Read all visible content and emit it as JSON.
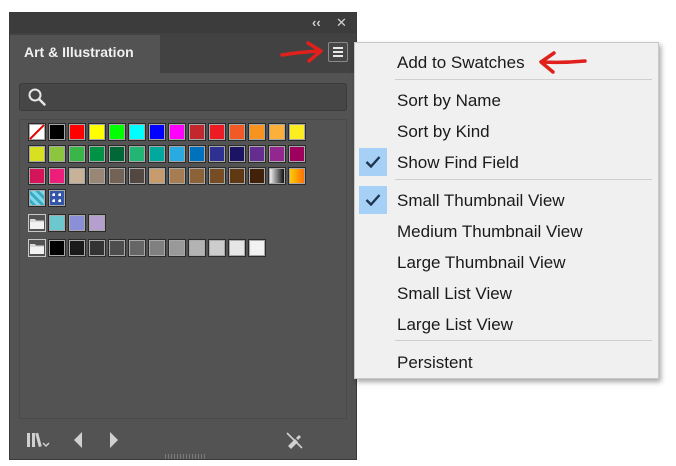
{
  "panel": {
    "collapse_glyph": "‹‹",
    "close_glyph": "✕",
    "tab_title": "Art & Illustration",
    "menu_button_icon": "hamburger-menu-icon",
    "search_icon": "search-icon",
    "search_value": ""
  },
  "swatch_rows": [
    [
      "none",
      "#000000",
      "#ff0000",
      "#ffff00",
      "#00ff00",
      "#00ffff",
      "#0000ff",
      "#ff00ff",
      "#c1272d",
      "#ed1c24",
      "#f15a24",
      "#f7931e",
      "#fbb03b",
      "#fcee21"
    ],
    [
      "#d9e021",
      "#8cc63f",
      "#39b54a",
      "#009245",
      "#006837",
      "#22b573",
      "#00a99d",
      "#29abe2",
      "#0071bc",
      "#2e3192",
      "#1b1464",
      "#662d91",
      "#93278f",
      "#9e005d"
    ],
    [
      "#d4145a",
      "#ed1e79",
      "#c7b299",
      "#998675",
      "#736357",
      "#534741",
      "#c69c6d",
      "#a67c52",
      "#8c6239",
      "#754c24",
      "#603813",
      "#42210b",
      "grad",
      "grad2"
    ],
    [
      "pat1",
      "pat2"
    ],
    [
      "folder",
      "#6dc7cf",
      "#8a8fd8",
      "#b49fce"
    ],
    [
      "folder",
      "#000000",
      "#1a1a1a",
      "#333333",
      "#4d4d4d",
      "#666666",
      "#808080",
      "#999999",
      "#b3b3b3",
      "#cccccc",
      "#e6e6e6",
      "#f2f2f2"
    ]
  ],
  "bottom_icons": [
    "libraries-icon",
    "previous-icon",
    "next-icon",
    "delete-swatch-icon"
  ],
  "menu": {
    "items": [
      {
        "label": "Add to Swatches",
        "checked": false
      },
      {
        "label": "Sort by Name",
        "checked": false
      },
      {
        "label": "Sort by Kind",
        "checked": false
      },
      {
        "label": "Show Find Field",
        "checked": true
      },
      {
        "label": "Small Thumbnail View",
        "checked": true
      },
      {
        "label": "Medium Thumbnail View",
        "checked": false
      },
      {
        "label": "Large Thumbnail View",
        "checked": false
      },
      {
        "label": "Small List View",
        "checked": false
      },
      {
        "label": "Large List View",
        "checked": false
      },
      {
        "label": "Persistent",
        "checked": false
      }
    ]
  },
  "accent_colors": {
    "arrow": "#e0201b",
    "check_bg": "#a6d0f5",
    "panel_bg": "#535353"
  }
}
